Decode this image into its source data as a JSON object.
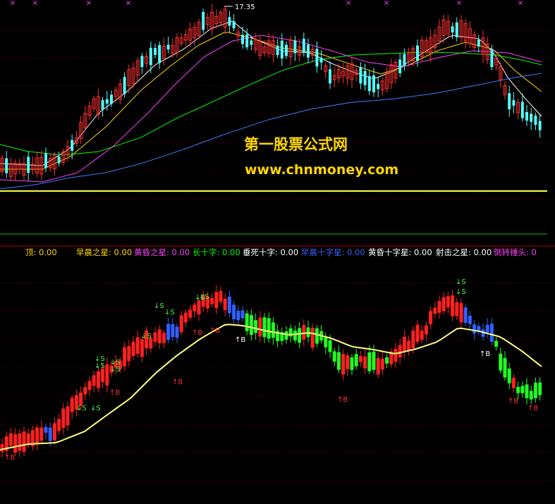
{
  "watermark": {
    "title": "第一股票公式网",
    "url": "www.chnmoney.com",
    "title_color": "#FFD700",
    "url_color": "#FFD700"
  },
  "upper_panel": {
    "peak_label": "17.35",
    "ma_colors": [
      "#FFFFFF",
      "#FFD700",
      "#FF40FF",
      "#00FF00",
      "#3A7FFF"
    ],
    "up_color": "#FF3030",
    "down_color": "#54FFFF",
    "yellow_line_color": "#FFFF40",
    "green_line_color": "#00C000"
  },
  "indicator_bar": {
    "items": [
      {
        "label": "顶: 0.00",
        "color": "#FFD700"
      },
      {
        "label": "早晨之星: 0.00",
        "color": "#FFD700"
      },
      {
        "label": "黄昏之星: 0.00",
        "color": "#FF40FF"
      },
      {
        "label": "长十字: 0.00",
        "color": "#00FF00"
      },
      {
        "label": "垂死十字: 0.00",
        "color": "#FFFFFF"
      },
      {
        "label": "早晨十字星: 0.00",
        "color": "#3A5FFF"
      },
      {
        "label": "黄昏十字星: 0.00",
        "color": "#FFFFFF"
      },
      {
        "label": "射击之星: 0.00",
        "color": "#FFFFFF"
      },
      {
        "label": "倒转锤头: 0",
        "color": "#FF40FF"
      }
    ]
  },
  "lower_panel": {
    "buy_label": "↑B",
    "sell_label": "↓S",
    "red_color": "#FF2020",
    "green_color": "#20FF20",
    "blue_color": "#3060FF",
    "signal_line_color": "#FFFF80",
    "buy_color_red": "#FF3030",
    "buy_color_white": "#FFFFFF",
    "sell_color": "#40FF40"
  },
  "chart_data": {
    "type": "candlestick",
    "title": "",
    "peak_price": 17.35,
    "indicators": [
      "MA",
      "trend candles",
      "B/S signals"
    ]
  }
}
